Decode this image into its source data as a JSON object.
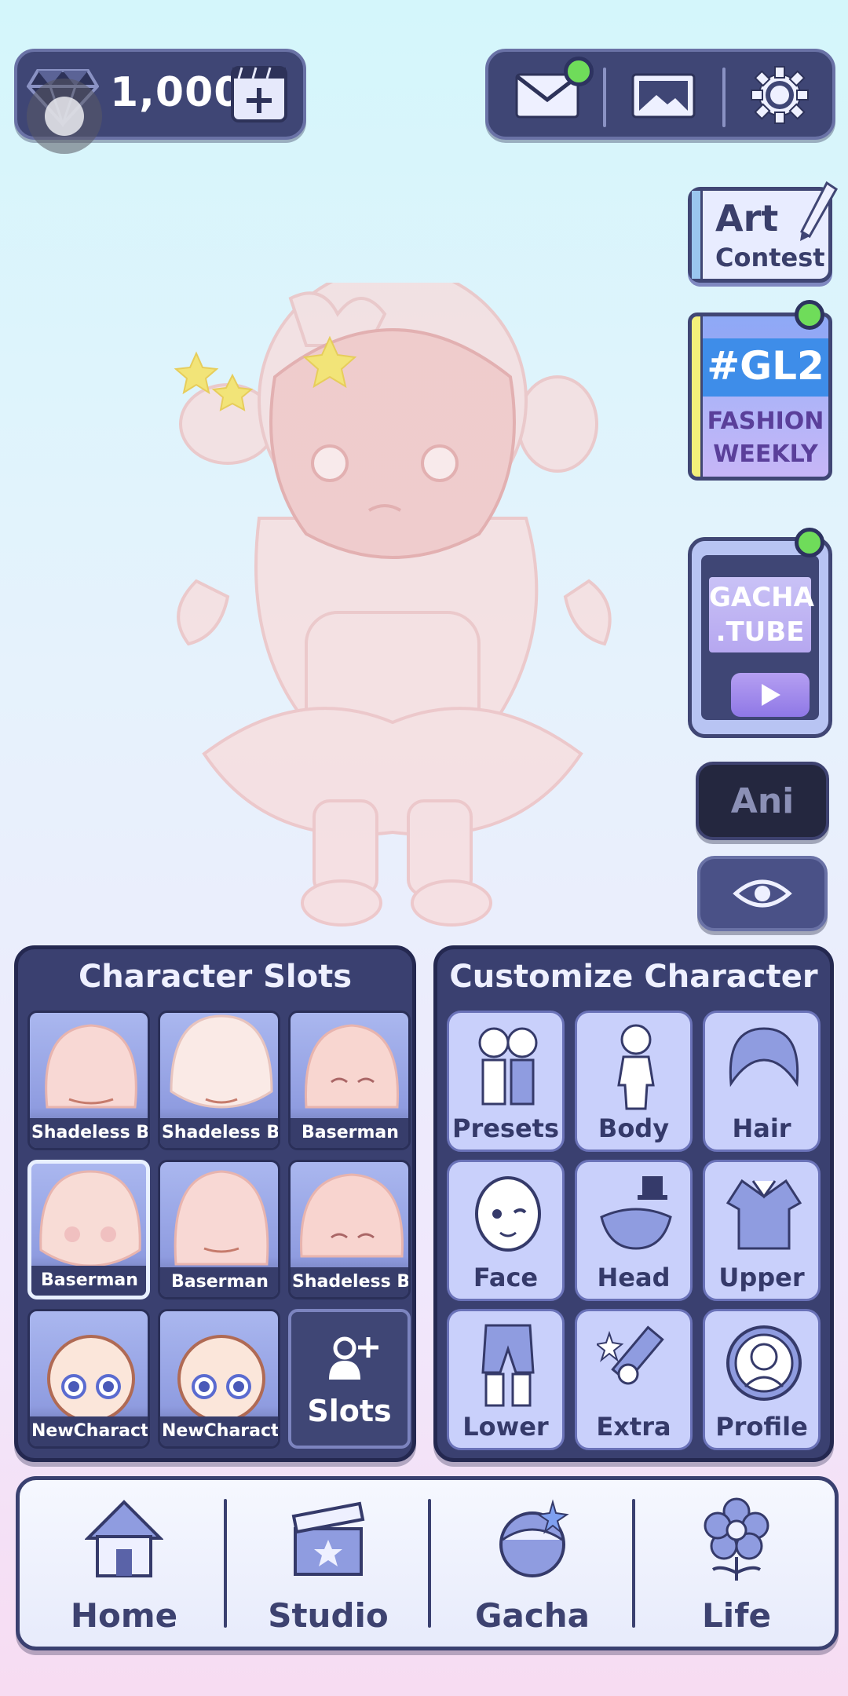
{
  "currency": {
    "gems": "1,000",
    "icon": "gem-icon",
    "add_icon": "add-video-icon"
  },
  "top_menu": {
    "mail_icon": "mail-icon",
    "gallery_icon": "image-icon",
    "settings_icon": "gear-icon"
  },
  "side": {
    "art_contest": {
      "line1": "Art",
      "line2": "Contest"
    },
    "fashion": {
      "title": "#GL2",
      "line1": "FASHION",
      "line2": "WEEKLY"
    },
    "tube": {
      "line1": "GACHA",
      "line2": ".TUBE"
    },
    "ani_label": "Ani",
    "eye_icon": "eye-icon"
  },
  "slots_panel": {
    "title": "Character Slots",
    "slots": [
      {
        "name": "Shadeless Base"
      },
      {
        "name": "Shadeless Base"
      },
      {
        "name": "Baserman"
      },
      {
        "name": "Baserman"
      },
      {
        "name": "Baserman"
      },
      {
        "name": "Shadeless Base"
      },
      {
        "name": "NewCharacter"
      },
      {
        "name": "NewCharacter"
      }
    ],
    "add_label": "Slots"
  },
  "customize_panel": {
    "title": "Customize Character",
    "items": [
      {
        "label": "Presets"
      },
      {
        "label": "Body"
      },
      {
        "label": "Hair"
      },
      {
        "label": "Face"
      },
      {
        "label": "Head"
      },
      {
        "label": "Upper"
      },
      {
        "label": "Lower"
      },
      {
        "label": "Extra"
      },
      {
        "label": "Profile"
      }
    ]
  },
  "nav": [
    {
      "label": "Home"
    },
    {
      "label": "Studio"
    },
    {
      "label": "Gacha"
    },
    {
      "label": "Life"
    }
  ],
  "colors": {
    "panel": "#3a4070",
    "accent_green": "#6fdc5a",
    "nav_bg": "#f6f8ff"
  }
}
